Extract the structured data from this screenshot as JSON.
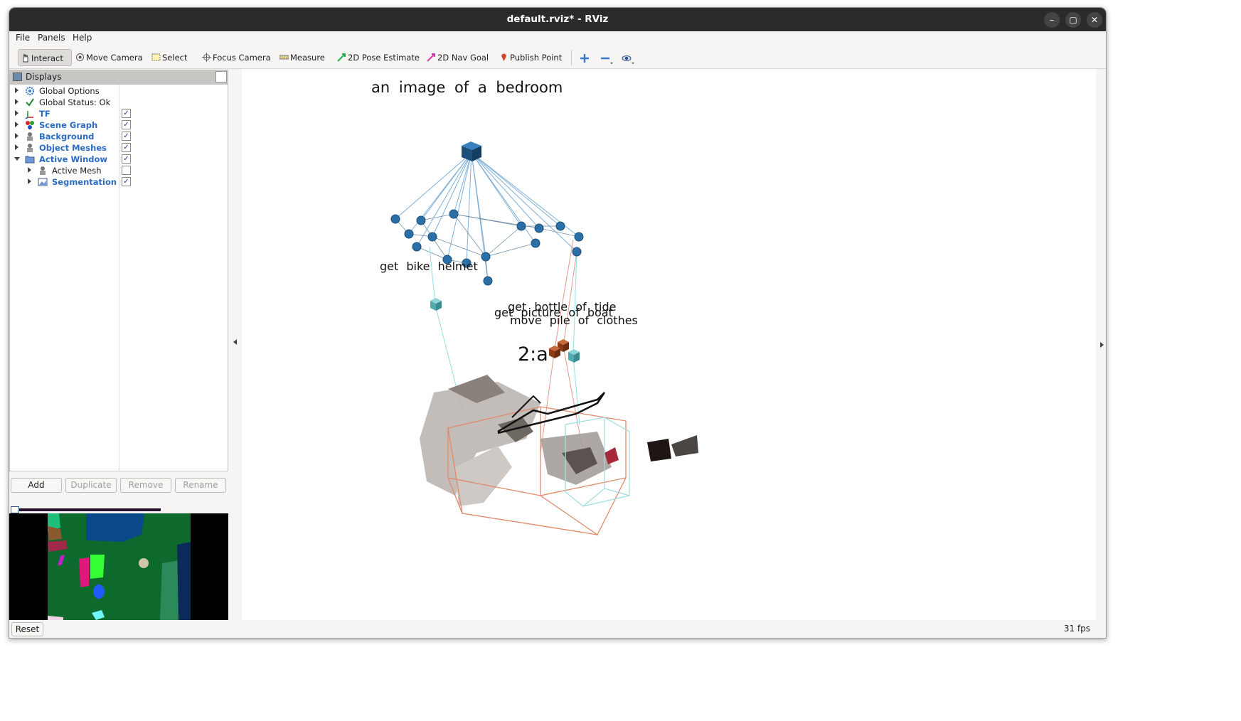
{
  "window": {
    "title": "default.rviz* - RViz",
    "controls": [
      "minimize",
      "maximize",
      "close"
    ]
  },
  "menu": {
    "items": [
      "File",
      "Panels",
      "Help"
    ]
  },
  "toolbar": {
    "tools": [
      {
        "label": "Interact",
        "icon": "hand-icon"
      },
      {
        "label": "Move Camera",
        "icon": "move-camera-icon"
      },
      {
        "label": "Select",
        "icon": "select-icon"
      },
      {
        "label": "Focus Camera",
        "icon": "focus-camera-icon"
      },
      {
        "label": "Measure",
        "icon": "measure-icon"
      },
      {
        "label": "2D Pose Estimate",
        "icon": "pose-arrow-icon"
      },
      {
        "label": "2D Nav Goal",
        "icon": "nav-goal-arrow-icon"
      },
      {
        "label": "Publish Point",
        "icon": "pin-icon"
      }
    ]
  },
  "displays": {
    "title": "Displays",
    "items": [
      {
        "label": "Global Options",
        "checked": null
      },
      {
        "label": "Global Status: Ok",
        "checked": null
      },
      {
        "label": "TF",
        "checked": true
      },
      {
        "label": "Scene Graph",
        "checked": true
      },
      {
        "label": "Background",
        "checked": true
      },
      {
        "label": "Object Meshes",
        "checked": true
      },
      {
        "label": "Active Window",
        "checked": true
      },
      {
        "label": "Active Mesh",
        "checked": false
      },
      {
        "label": "Segmentation",
        "checked": true
      }
    ],
    "check_mark": "✓"
  },
  "panel_buttons": {
    "add": "Add",
    "duplicate": "Duplicate",
    "remove": "Remove",
    "rename": "Rename"
  },
  "status": {
    "reset": "Reset",
    "fps": "31 fps"
  },
  "scene": {
    "caption": "an image of a bedroom",
    "labels": {
      "get_bike_helmet": "get bike helmet",
      "get_bottle_of_tide": "get bottle of tide",
      "get_picture_of_boat": "get picture of boat",
      "move_pile_of_clothes": "move pile of clothes",
      "room_id": "2:a"
    },
    "colors": {
      "node": "#2a6fa6",
      "root": "#1c4f7a",
      "cyan": "#5fbfc4",
      "brown": "#8e3b14",
      "box": "#e0896a"
    }
  }
}
